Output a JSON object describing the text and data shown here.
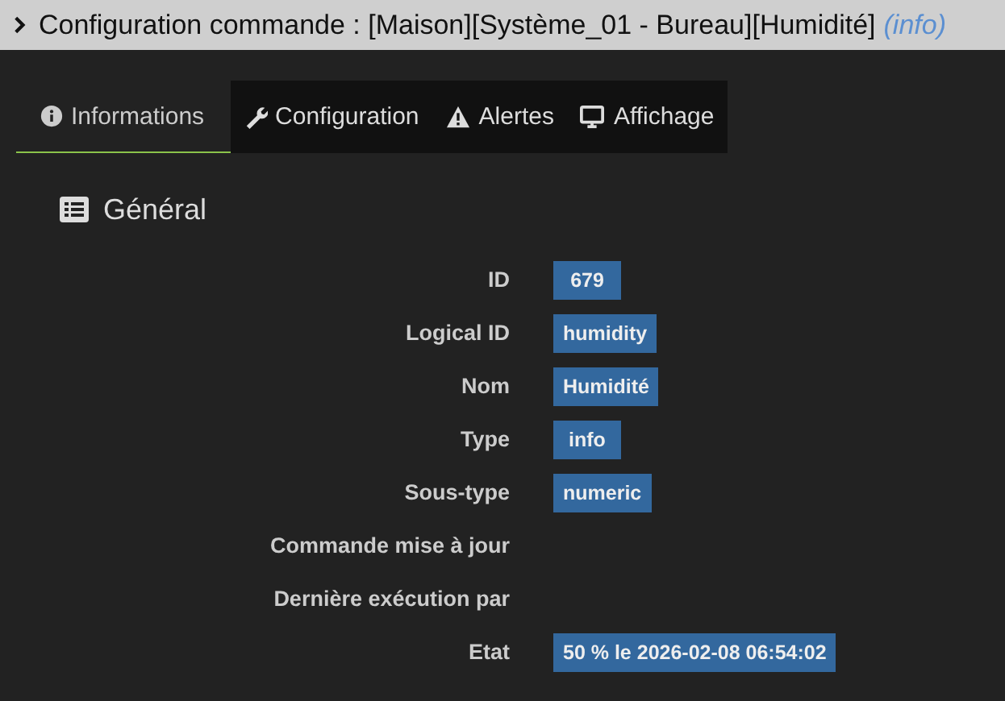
{
  "header": {
    "title": "Configuration commande : [Maison][Système_01 - Bureau][Humidité]",
    "subtitle": "(info)"
  },
  "tabs": [
    {
      "label": "Informations",
      "kind": "info",
      "selected": true
    },
    {
      "label": "Configuration",
      "kind": "wrench",
      "selected": false
    },
    {
      "label": "Alertes",
      "kind": "warning",
      "selected": false
    },
    {
      "label": "Affichage",
      "kind": "monitor",
      "selected": false
    }
  ],
  "section": {
    "title": "Général"
  },
  "fields": [
    {
      "label": "ID",
      "value": "679"
    },
    {
      "label": "Logical ID",
      "value": "humidity"
    },
    {
      "label": "Nom",
      "value": "Humidité"
    },
    {
      "label": "Type",
      "value": "info"
    },
    {
      "label": "Sous-type",
      "value": "numeric"
    },
    {
      "label": "Commande mise à jour"
    },
    {
      "label": "Dernière exécution par"
    },
    {
      "label": "Etat",
      "value": "50 % le 2026-02-08 06:54:02"
    }
  ]
}
